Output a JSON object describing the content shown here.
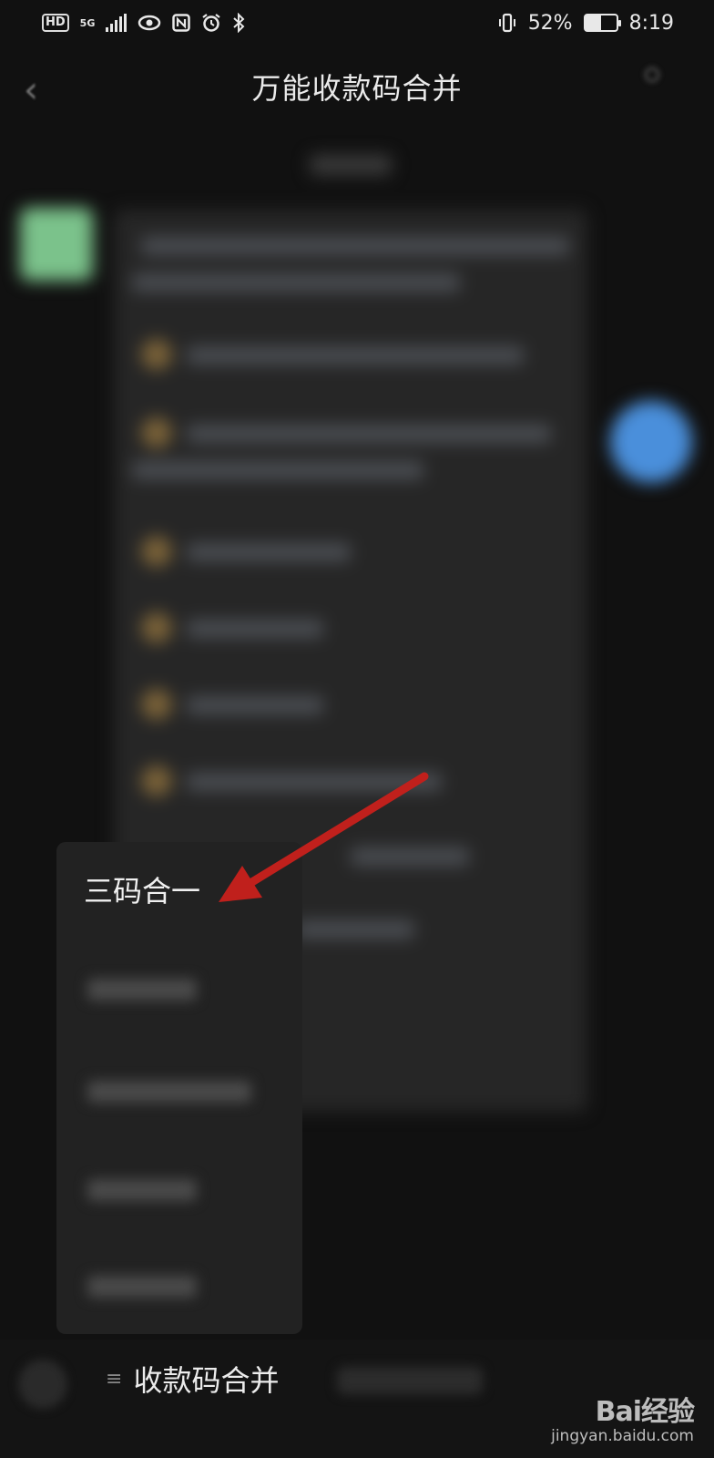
{
  "status_bar": {
    "hd": "HD",
    "network": "5G",
    "battery_percent": "52%",
    "battery_level": 0.52,
    "time": "8:19"
  },
  "header": {
    "title": "万能收款码合并",
    "back_icon": "chevron-left-icon",
    "profile_icon": "person-icon"
  },
  "popup_menu": {
    "first_item": "三码合一"
  },
  "bottom_bar": {
    "menu_icon": "hamburger-icon",
    "menu_label": "收款码合并"
  },
  "watermark": {
    "brand": "Bai经验",
    "url": "jingyan.baidu.com"
  },
  "colors": {
    "background": "#111111",
    "arrow": "#c0201c",
    "menu": "#222222"
  }
}
